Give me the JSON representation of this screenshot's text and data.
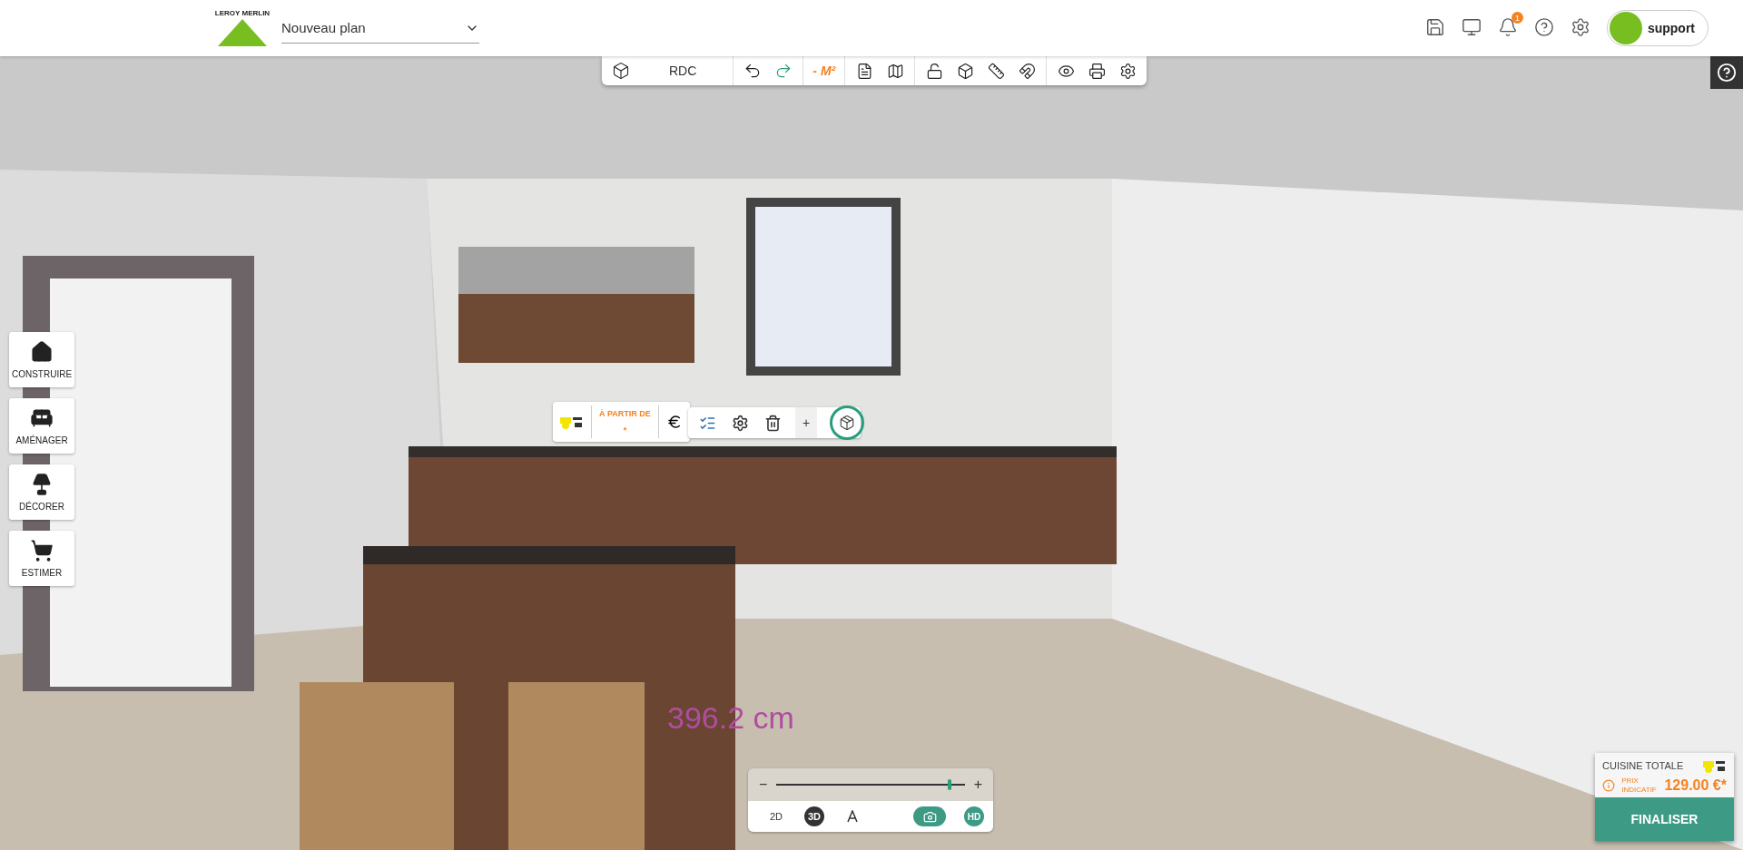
{
  "header": {
    "logo_text": "LEROY MERLIN",
    "plan_name": "Nouveau plan",
    "notification_count": "1",
    "support_label": "support"
  },
  "toolbar": {
    "level": "RDC",
    "area": "- M²"
  },
  "sidebar": {
    "items": [
      {
        "label": "CONSTRUIRE",
        "kind": "build"
      },
      {
        "label": "AMÉNAGER",
        "kind": "furnish"
      },
      {
        "label": "DÉCORER",
        "kind": "decorate"
      },
      {
        "label": "ESTIMER",
        "kind": "estimate"
      }
    ]
  },
  "object_popup": {
    "price_label": "À PARTIR DE",
    "price_value": "*",
    "add_label": "+"
  },
  "dimension": "396.2 cm",
  "view_controls": {
    "zoom": {
      "level": 0.92,
      "minus": "−",
      "plus": "+"
    },
    "modes": [
      {
        "label": "2D",
        "selected": false
      },
      {
        "label": "3D",
        "selected": true
      }
    ],
    "hd_label": "HD"
  },
  "price_card": {
    "title": "CUISINE TOTALE",
    "note": "PRIX INDICATIF",
    "price": "129.00 €*",
    "button": "FINALISER"
  }
}
